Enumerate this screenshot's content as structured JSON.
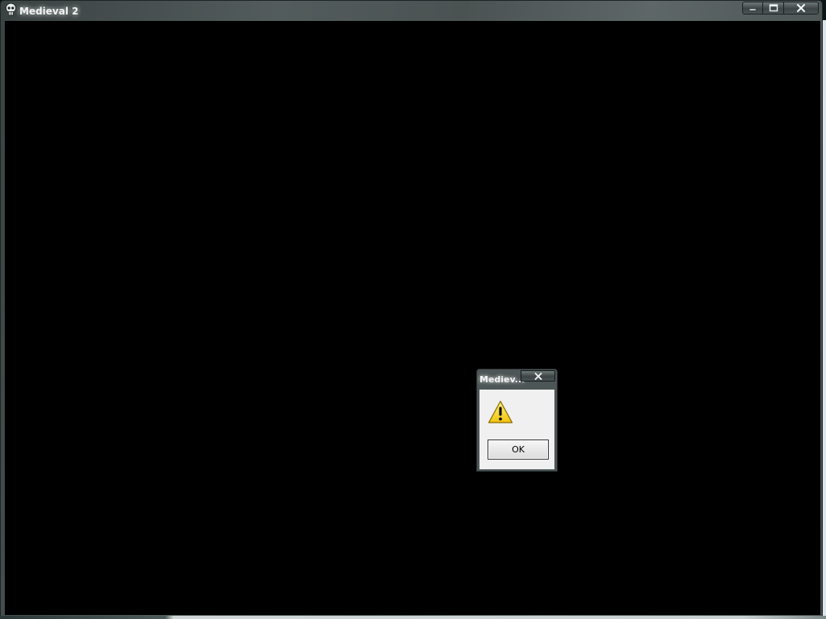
{
  "window": {
    "title": "Medieval 2",
    "icons": {
      "app": "skull-icon",
      "minimize": "minimize-icon",
      "maximize": "maximize-icon",
      "close": "close-icon"
    }
  },
  "dialog": {
    "title": "Mediev...",
    "icon": "warning-icon",
    "close_icon": "close-icon",
    "ok_label": "OK"
  },
  "colors": {
    "client_background": "#000000",
    "warning_yellow": "#f7d81a",
    "title_text": "#f2f4f4"
  }
}
